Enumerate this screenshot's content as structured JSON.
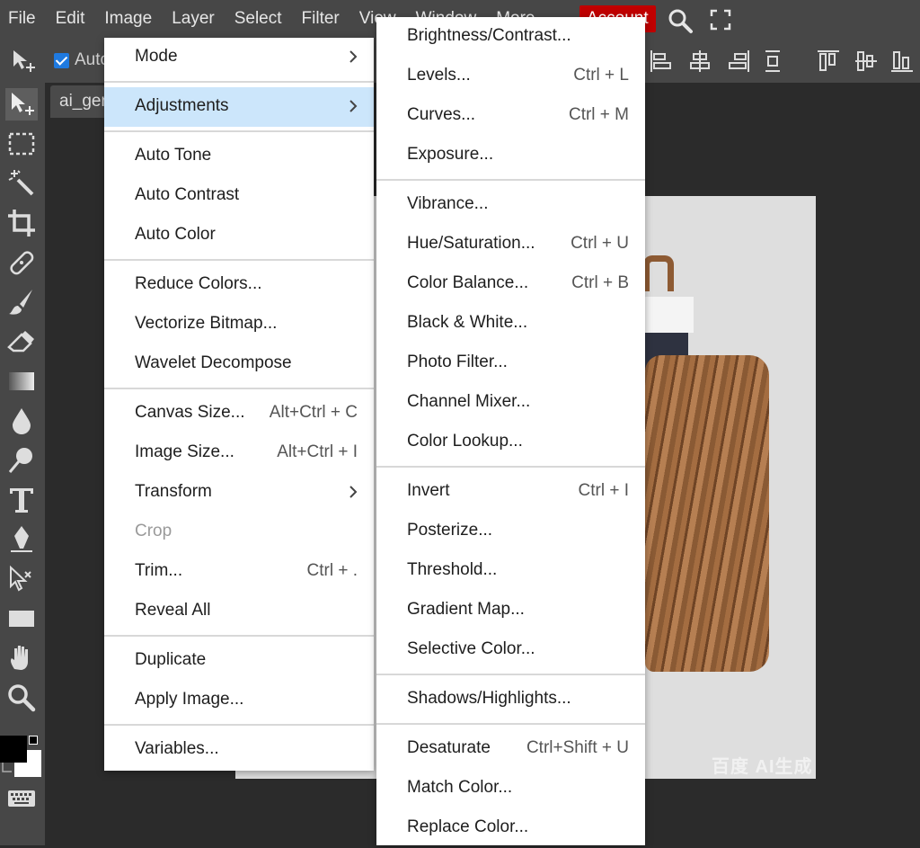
{
  "menubar": {
    "items": [
      "File",
      "Edit",
      "Image",
      "Layer",
      "Select",
      "Filter",
      "View",
      "Window",
      "More"
    ],
    "account": "Account",
    "accent_color": "#c00000"
  },
  "options": {
    "auto_select_label": "Auto",
    "auto_select_checked": true
  },
  "document": {
    "tab_title": "ai_gen",
    "watermark": "百度 AI生成"
  },
  "image_menu": {
    "items": [
      {
        "label": "Mode",
        "submenu": true
      },
      {
        "label": "Adjustments",
        "submenu": true,
        "highlighted": true
      },
      {
        "label": "Auto Tone"
      },
      {
        "label": "Auto Contrast"
      },
      {
        "label": "Auto Color"
      },
      {
        "label": "Reduce Colors..."
      },
      {
        "label": "Vectorize Bitmap..."
      },
      {
        "label": "Wavelet Decompose"
      },
      {
        "label": "Canvas Size...",
        "shortcut": "Alt+Ctrl + C"
      },
      {
        "label": "Image Size...",
        "shortcut": "Alt+Ctrl + I"
      },
      {
        "label": "Transform",
        "submenu": true
      },
      {
        "label": "Crop",
        "disabled": true
      },
      {
        "label": "Trim...",
        "shortcut": "Ctrl + ."
      },
      {
        "label": "Reveal All"
      },
      {
        "label": "Duplicate"
      },
      {
        "label": "Apply Image..."
      },
      {
        "label": "Variables..."
      }
    ]
  },
  "adjustments_menu": {
    "items": [
      {
        "label": "Brightness/Contrast..."
      },
      {
        "label": "Levels...",
        "shortcut": "Ctrl + L"
      },
      {
        "label": "Curves...",
        "shortcut": "Ctrl + M"
      },
      {
        "label": "Exposure..."
      },
      {
        "label": "Vibrance..."
      },
      {
        "label": "Hue/Saturation...",
        "shortcut": "Ctrl + U"
      },
      {
        "label": "Color Balance...",
        "shortcut": "Ctrl + B"
      },
      {
        "label": "Black & White..."
      },
      {
        "label": "Photo Filter..."
      },
      {
        "label": "Channel Mixer..."
      },
      {
        "label": "Color Lookup..."
      },
      {
        "label": "Invert",
        "shortcut": "Ctrl + I"
      },
      {
        "label": "Posterize..."
      },
      {
        "label": "Threshold..."
      },
      {
        "label": "Gradient Map..."
      },
      {
        "label": "Selective Color..."
      },
      {
        "label": "Shadows/Highlights..."
      },
      {
        "label": "Desaturate",
        "shortcut": "Ctrl+Shift + U"
      },
      {
        "label": "Match Color..."
      },
      {
        "label": "Replace Color..."
      }
    ]
  },
  "colors": {
    "foreground": "#000000",
    "background": "#ffffff",
    "menu_highlight": "#cce6fb"
  }
}
